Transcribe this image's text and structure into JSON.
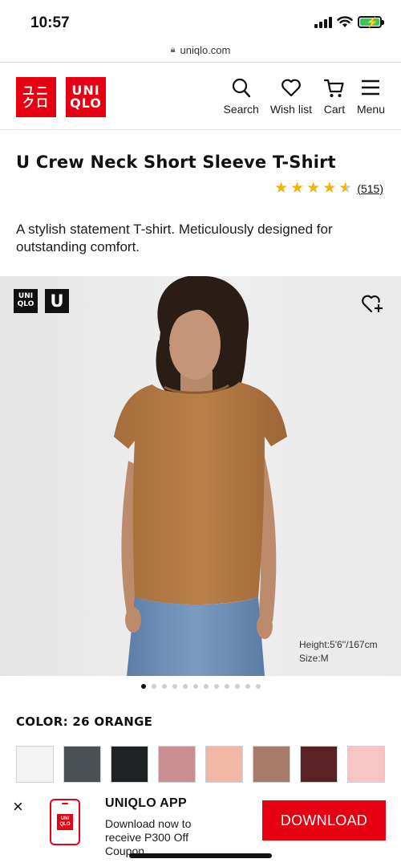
{
  "status_bar": {
    "time": "10:57"
  },
  "browser": {
    "url": "uniqlo.com"
  },
  "header": {
    "logo_kanji_row1": "ユニ",
    "logo_kanji_row2": "クロ",
    "logo_latin_row1": "UNI",
    "logo_latin_row2": "QLO",
    "nav": [
      {
        "label": "Search",
        "icon": "search-icon"
      },
      {
        "label": "Wish list",
        "icon": "heart-icon"
      },
      {
        "label": "Cart",
        "icon": "cart-icon"
      },
      {
        "label": "Menu",
        "icon": "menu-icon"
      }
    ]
  },
  "product": {
    "title": "U Crew Neck Short Sleeve T-Shirt",
    "rating": 4.5,
    "review_count": "(515)",
    "description": "A stylish statement T-shirt. Meticulously designed for outstanding comfort.",
    "badge_uniqlo_row1": "UNI",
    "badge_uniqlo_row2": "QLO",
    "badge_u": "U",
    "model_height": "Height:5'6''/167cm",
    "model_size": "Size:M",
    "image_count": 12,
    "active_image": 1,
    "color_label": "COLOR: 26 ORANGE",
    "swatches": [
      "#f4f4f4",
      "#4a5155",
      "#1f2222",
      "#c98e92",
      "#efb9a6",
      "#a67b69",
      "#5a2227",
      "#f7c6c2"
    ]
  },
  "app_banner": {
    "close": "×",
    "title": "UNIQLO APP",
    "subtitle": "Download now to receive P300 Off Coupon",
    "button": "DOWNLOAD",
    "icon_row1": "UNI",
    "icon_row2": "QLO"
  },
  "colors": {
    "brand_red": "#e60012",
    "star": "#f1b400",
    "shirt": "#b07a45"
  }
}
